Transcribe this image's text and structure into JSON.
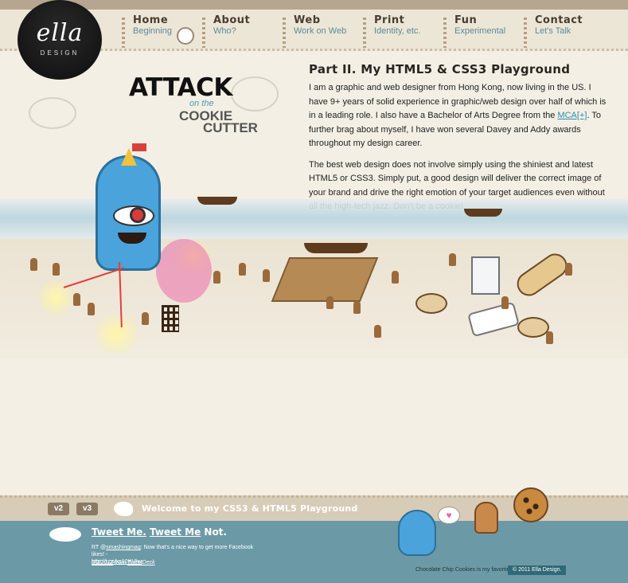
{
  "logo": {
    "word": "ella",
    "sub": "DESIGN"
  },
  "nav": [
    {
      "main": "Home",
      "sub": "Beginning"
    },
    {
      "main": "About",
      "sub": "Who?"
    },
    {
      "main": "Web",
      "sub": "Work on Web"
    },
    {
      "main": "Print",
      "sub": "Identity, etc."
    },
    {
      "main": "Fun",
      "sub": "Experimental"
    },
    {
      "main": "Contact",
      "sub": "Let's Talk"
    }
  ],
  "hero": {
    "attack": "ATTACK",
    "on_the": "on the",
    "cookie": "COOKIE",
    "cutter": "CUTTER"
  },
  "content": {
    "heading": "Part II. My HTML5 & CSS3 Playground",
    "p1_before": "I am a graphic and web designer from Hong Kong, now living in the US. I have 9+ years of solid experience in graphic/web design over half of which is in a leading role. I also have a Bachelor of Arts Degree from the ",
    "p1_link": "MCA[+]",
    "p1_after": ". To further brag about myself, I have won several Davey and Addy awards throughout my design career.",
    "p2": "The best web design does not involve simply using the shiniest and latest HTML5 or CSS3. Simply put, a good design will deliver the correct image of your brand and drive the right emotion of your target audiences even without all the high-tech jazz. Don't be a cookie!"
  },
  "footer": {
    "v2": "v2",
    "v3": "v3",
    "welcome": "Welcome to my CSS3 & HTML5 Playground",
    "tweet_part1": "Tweet Me.",
    "tweet_part2": "Tweet Me",
    "tweet_part3": " Not.",
    "tweet_rt": "RT @",
    "tweet_handle": "smashingmag",
    "tweet_body": ": Now that's a nice way to get more Facebook likes! -",
    "tweet_link": "http://t.co/xs10HVhu",
    "tweet_date": "8/2/2012",
    "tweet_from": " from ",
    "tweet_source": "TweetDeck",
    "chip_note": "Chocolate Chip Cookies is my favorite!",
    "copyright": "© 2011 Ella Design."
  },
  "colors": {
    "nav_bg": "#ece6d7",
    "accent_teal": "#5e8a96",
    "footer_bg": "#6b9aa6",
    "monster_blue": "#4aa3da"
  }
}
